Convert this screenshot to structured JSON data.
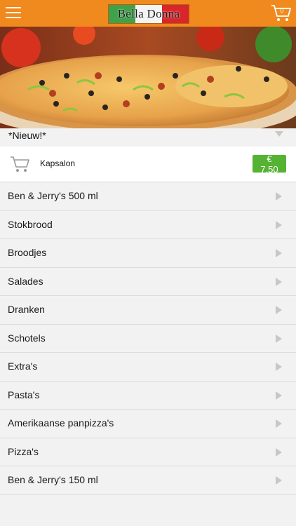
{
  "header": {
    "logo_text": "Bella Donna",
    "cart_count": "0",
    "brand_color": "#f08a1e"
  },
  "section": {
    "title": "*Nieuw!*"
  },
  "featured_product": {
    "name": "Kapsalon",
    "price": "€ 7,50",
    "price_color": "#55b233"
  },
  "categories": [
    "Ben & Jerry's 500 ml",
    "Stokbrood",
    "Broodjes",
    "Salades",
    "Dranken",
    "Schotels",
    "Extra's",
    "Pasta's",
    "Amerikaanse panpizza's",
    "Pizza's",
    "Ben & Jerry's 150 ml"
  ]
}
